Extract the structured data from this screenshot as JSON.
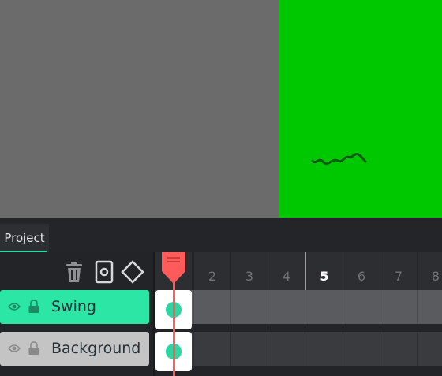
{
  "panel": {
    "tab_label": "Project"
  },
  "toolbar": {
    "icons": [
      "trash-icon",
      "camera-icon",
      "keyframe-icon"
    ]
  },
  "layers": [
    {
      "name": "Swing",
      "active": true
    },
    {
      "name": "Background",
      "active": false
    }
  ],
  "timeline": {
    "frame_numbers": [
      "",
      "2",
      "3",
      "4",
      "5",
      "6",
      "7",
      "8"
    ],
    "current_frame": "5"
  },
  "colors": {
    "accent": "#2bd6a1",
    "playhead": "#ff5b5b",
    "canvas": "#00c800"
  }
}
